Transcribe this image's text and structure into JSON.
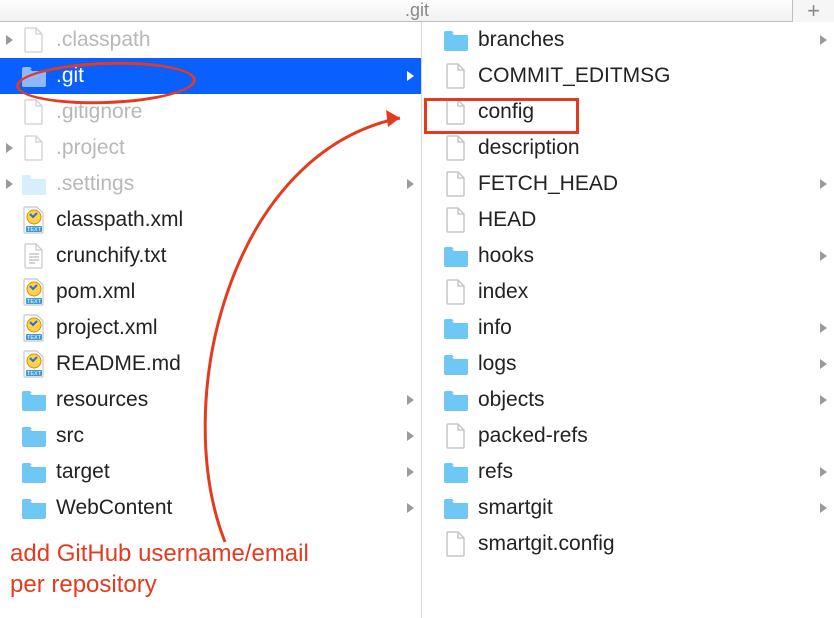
{
  "title": ".git",
  "annotation_text": "add GitHub username/email\nper repository",
  "left": [
    {
      "label": ".classpath",
      "icon": "file-dim",
      "dim": true,
      "disclose_left": true
    },
    {
      "label": ".git",
      "icon": "folder-dim",
      "dim": true,
      "selected": true,
      "disclose_left": true,
      "disclose_right": true
    },
    {
      "label": ".gitignore",
      "icon": "file-dim",
      "dim": true
    },
    {
      "label": ".project",
      "icon": "file-dim",
      "dim": true,
      "disclose_left": true
    },
    {
      "label": ".settings",
      "icon": "folder-dim",
      "dim": true,
      "disclose_left": true,
      "disclose_right": true
    },
    {
      "label": "classpath.xml",
      "icon": "xml"
    },
    {
      "label": "crunchify.txt",
      "icon": "txt"
    },
    {
      "label": "pom.xml",
      "icon": "xml"
    },
    {
      "label": "project.xml",
      "icon": "xml"
    },
    {
      "label": "README.md",
      "icon": "xml"
    },
    {
      "label": "resources",
      "icon": "folder",
      "disclose_right": true
    },
    {
      "label": "src",
      "icon": "folder",
      "disclose_right": true
    },
    {
      "label": "target",
      "icon": "folder",
      "disclose_right": true
    },
    {
      "label": "WebContent",
      "icon": "folder",
      "disclose_right": true
    }
  ],
  "right": [
    {
      "label": "branches",
      "icon": "folder",
      "disclose_right": true
    },
    {
      "label": "COMMIT_EDITMSG",
      "icon": "file"
    },
    {
      "label": "config",
      "icon": "file"
    },
    {
      "label": "description",
      "icon": "file"
    },
    {
      "label": "FETCH_HEAD",
      "icon": "file",
      "disclose_right": true
    },
    {
      "label": "HEAD",
      "icon": "file"
    },
    {
      "label": "hooks",
      "icon": "folder",
      "disclose_right": true
    },
    {
      "label": "index",
      "icon": "file"
    },
    {
      "label": "info",
      "icon": "folder",
      "disclose_right": true
    },
    {
      "label": "logs",
      "icon": "folder",
      "disclose_right": true
    },
    {
      "label": "objects",
      "icon": "folder",
      "disclose_right": true
    },
    {
      "label": "packed-refs",
      "icon": "file"
    },
    {
      "label": "refs",
      "icon": "folder",
      "disclose_right": true
    },
    {
      "label": "smartgit",
      "icon": "folder",
      "disclose_right": true
    },
    {
      "label": "smartgit.config",
      "icon": "file"
    }
  ]
}
